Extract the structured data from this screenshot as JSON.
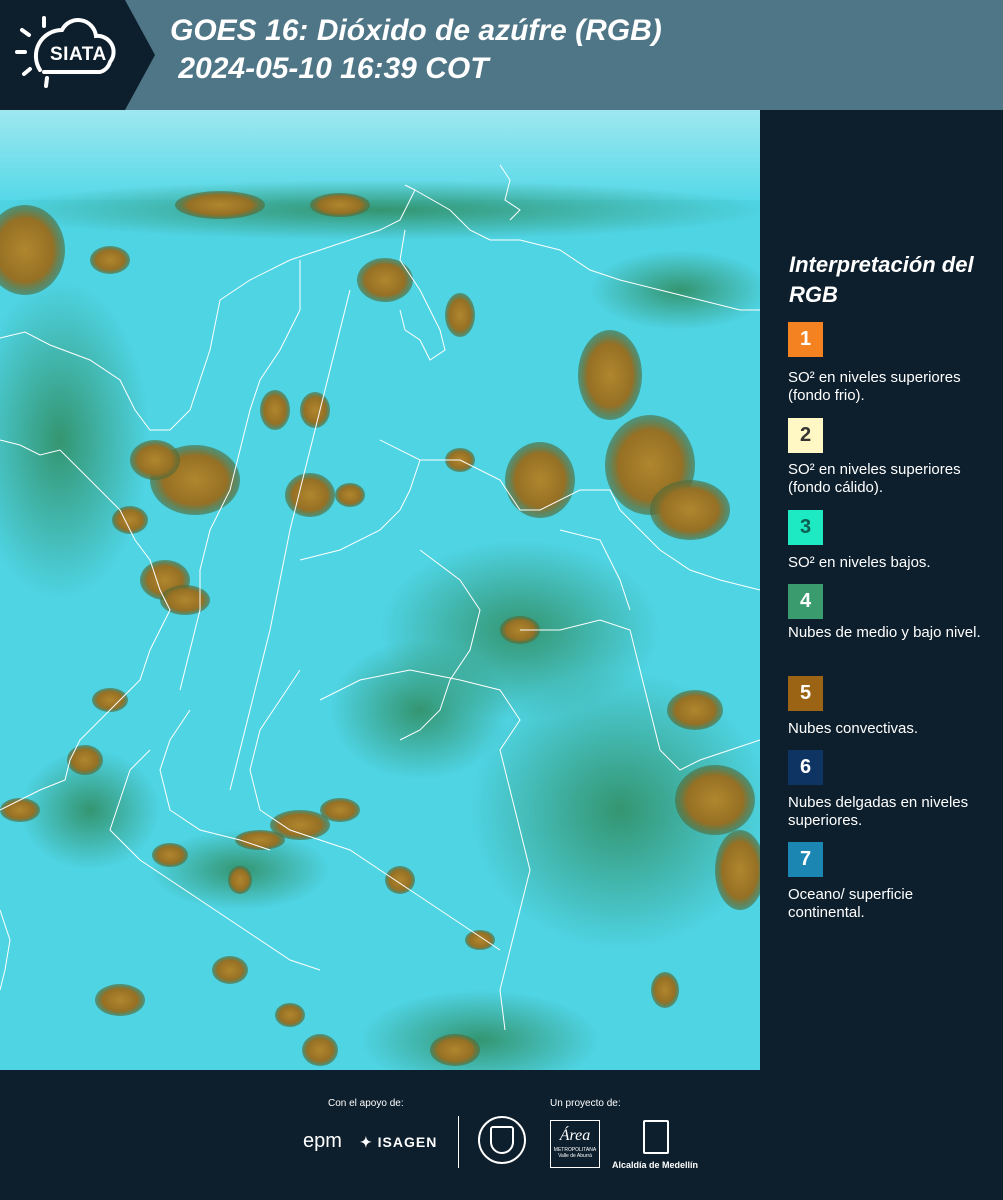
{
  "header": {
    "logo_text": "SIATA",
    "title": "GOES 16: Dióxido de azúfre (RGB)\n 2024-05-10 16:39 COT"
  },
  "legend": {
    "title": "Interpretación del RGB",
    "items": [
      {
        "number": "1",
        "color": "#f58220",
        "label": "SO² en niveles superiores (fondo frio)."
      },
      {
        "number": "2",
        "color": "#fff7c4",
        "label": "SO² en niveles superiores (fondo cálido)."
      },
      {
        "number": "3",
        "color": "#1de9c3",
        "label": "SO² en niveles bajos."
      },
      {
        "number": "4",
        "color": "#3a9b6e",
        "label": "Nubes de medio y bajo nivel."
      },
      {
        "number": "5",
        "color": "#9a6414",
        "label": "Nubes convectivas."
      },
      {
        "number": "6",
        "color": "#0d3463",
        "label": "Nubes delgadas en niveles superiores."
      },
      {
        "number": "7",
        "color": "#1b86b2",
        "label": "Oceano/ superficie continental."
      }
    ]
  },
  "footer": {
    "support_label": "Con el apoyo de:",
    "project_label": "Un proyecto de:",
    "sponsor_1": "epm",
    "sponsor_2": "ISAGEN",
    "partner_1_text": "Área",
    "partner_1_sub": "METROPOLITANA Valle de Aburrá",
    "partner_2": "Alcaldía de Medellín"
  },
  "colors": {
    "header_bg": "#4f7686",
    "dark_bg": "#0d1f2d",
    "map_cyan": "#3cd6e6",
    "cloud_brown": "#a0782a",
    "cloud_green": "#2f8a5c",
    "border_white": "#ffffff"
  }
}
